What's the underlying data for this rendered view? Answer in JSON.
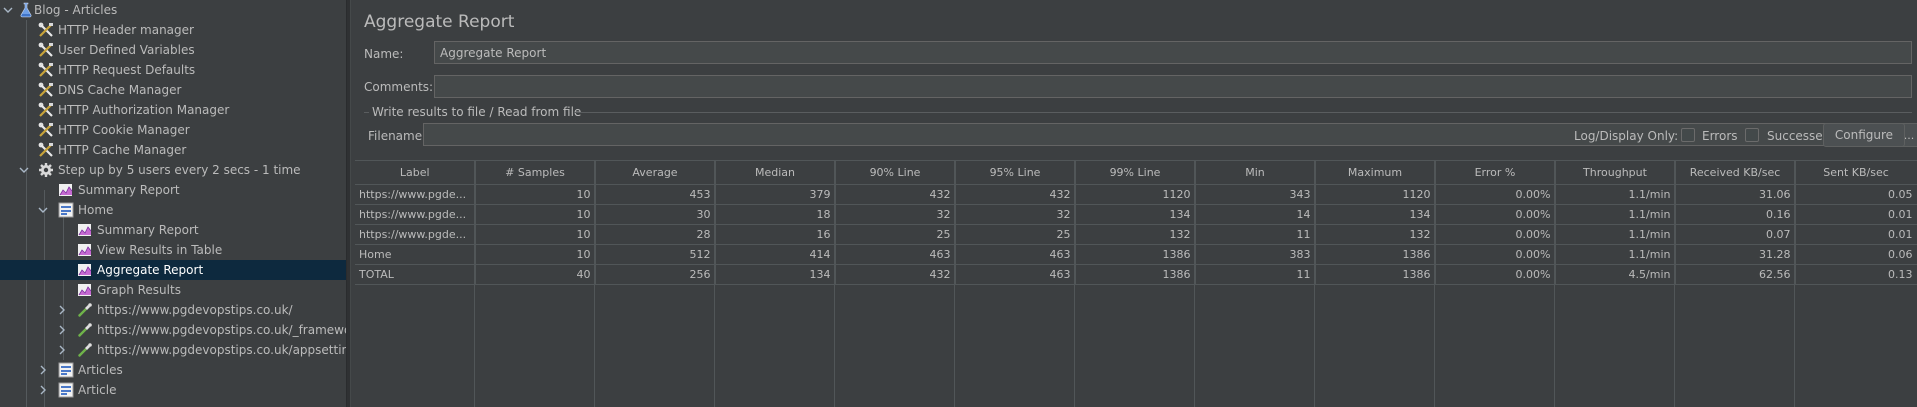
{
  "tree": {
    "root": "Blog - Articles",
    "items": [
      {
        "label": "HTTP Header manager",
        "icon": "config-element-icon"
      },
      {
        "label": "User Defined Variables",
        "icon": "config-element-icon"
      },
      {
        "label": "HTTP Request Defaults",
        "icon": "config-element-icon"
      },
      {
        "label": "DNS Cache Manager",
        "icon": "config-element-icon"
      },
      {
        "label": "HTTP Authorization Manager",
        "icon": "config-element-icon"
      },
      {
        "label": "HTTP Cookie Manager",
        "icon": "config-element-icon"
      },
      {
        "label": "HTTP Cache Manager",
        "icon": "config-element-icon"
      },
      {
        "label": "Step up by 5 users every 2 secs - 1 time",
        "icon": "thread-group-gear-icon"
      },
      {
        "label": "Summary Report",
        "icon": "listener-icon"
      },
      {
        "label": "Home",
        "icon": "transaction-controller-icon"
      },
      {
        "label": "Summary Report",
        "icon": "listener-icon"
      },
      {
        "label": "View Results in Table",
        "icon": "listener-icon"
      },
      {
        "label": "Aggregate Report",
        "icon": "listener-icon"
      },
      {
        "label": "Graph Results",
        "icon": "listener-icon"
      },
      {
        "label": "https://www.pgdevopstips.co.uk/",
        "icon": "sampler-pipette-icon"
      },
      {
        "label": "https://www.pgdevopstips.co.uk/_framework/",
        "icon": "sampler-pipette-icon"
      },
      {
        "label": "https://www.pgdevopstips.co.uk/appsettings.",
        "icon": "sampler-pipette-icon"
      },
      {
        "label": "Articles",
        "icon": "transaction-controller-icon"
      },
      {
        "label": "Article",
        "icon": "transaction-controller-icon"
      }
    ]
  },
  "panel": {
    "title": "Aggregate Report",
    "name_label": "Name:",
    "name_value": "Aggregate Report",
    "comments_label": "Comments:",
    "comments_value": "",
    "group_title": "Write results to file / Read from file",
    "filename_label": "Filename",
    "filename_value": "",
    "browse_label": "Browse...",
    "log_display_label": "Log/Display Only:",
    "errors_label": "Errors",
    "successes_label": "Successes",
    "configure_label": "Configure"
  },
  "table": {
    "headers": [
      "Label",
      "# Samples",
      "Average",
      "Median",
      "90% Line",
      "95% Line",
      "99% Line",
      "Min",
      "Maximum",
      "Error %",
      "Throughput",
      "Received KB/sec",
      "Sent KB/sec"
    ],
    "rows": [
      [
        "https://www.pgde...",
        "10",
        "453",
        "379",
        "432",
        "432",
        "1120",
        "343",
        "1120",
        "0.00%",
        "1.1/min",
        "31.06",
        "0.05"
      ],
      [
        "https://www.pgde...",
        "10",
        "30",
        "18",
        "32",
        "32",
        "134",
        "14",
        "134",
        "0.00%",
        "1.1/min",
        "0.16",
        "0.01"
      ],
      [
        "https://www.pgde...",
        "10",
        "28",
        "16",
        "25",
        "25",
        "132",
        "11",
        "132",
        "0.00%",
        "1.1/min",
        "0.07",
        "0.01"
      ],
      [
        "Home",
        "10",
        "512",
        "414",
        "463",
        "463",
        "1386",
        "383",
        "1386",
        "0.00%",
        "1.1/min",
        "31.28",
        "0.06"
      ],
      [
        "TOTAL",
        "40",
        "256",
        "134",
        "432",
        "463",
        "1386",
        "11",
        "1386",
        "0.00%",
        "4.5/min",
        "62.56",
        "0.13"
      ]
    ]
  }
}
